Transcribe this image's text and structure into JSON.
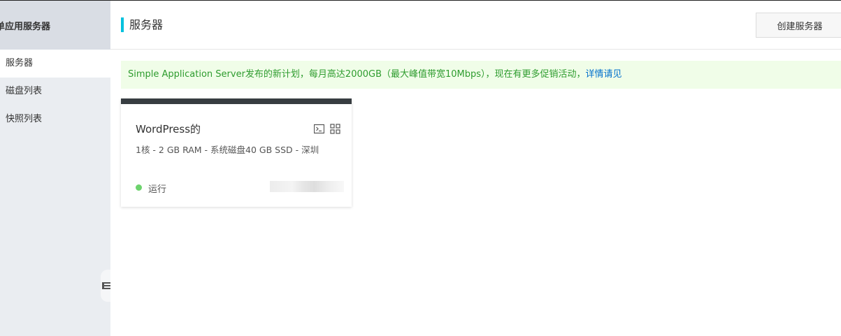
{
  "sidebar": {
    "title": "单应用服务器",
    "items": [
      {
        "label": "服务器",
        "active": true
      },
      {
        "label": "磁盘列表",
        "active": false
      },
      {
        "label": "快照列表",
        "active": false
      }
    ]
  },
  "header": {
    "title": "服务器",
    "create_label": "创建服务器"
  },
  "notice": {
    "text": "Simple Application Server发布的新计划，每月高达2000GB（最大峰值带宽10Mbps），现在有更多促销活动，",
    "link": "详情请见"
  },
  "servers": [
    {
      "name": "WordPress的",
      "spec": "1核 - 2 GB RAM - 系统磁盘40 GB SSD - 深圳",
      "status": "运行",
      "status_color": "#6dd36d"
    }
  ],
  "colors": {
    "accent": "#00c1de",
    "notice_text": "#2e9c2e",
    "link": "#0070cc",
    "card_top": "#373d41"
  },
  "icons": [
    "terminal-icon",
    "grid-icon",
    "collapse-menu-icon"
  ]
}
